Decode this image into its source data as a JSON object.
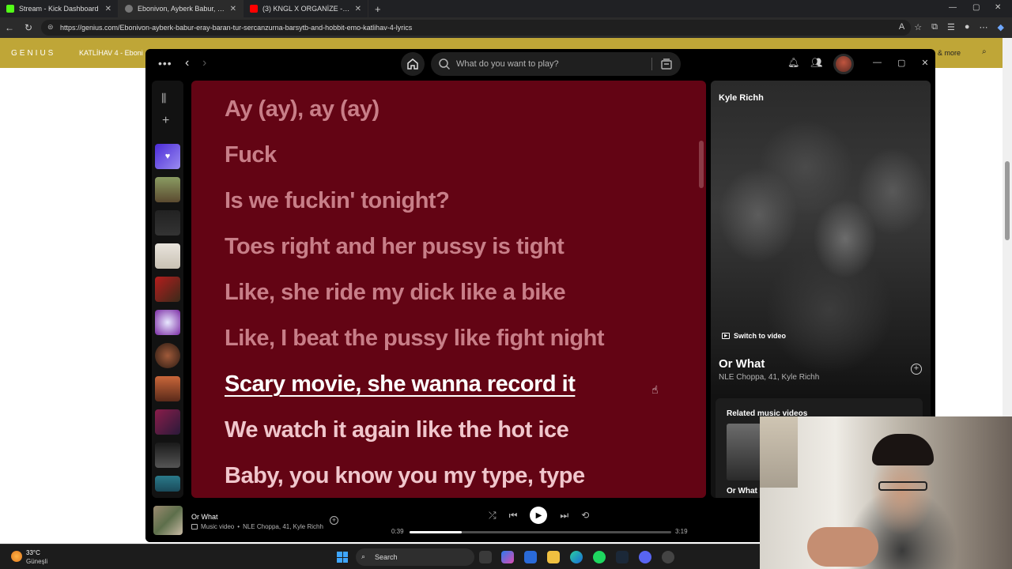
{
  "browser": {
    "tabs": [
      {
        "label": "Stream - Kick Dashboard",
        "color": "#53fc18"
      },
      {
        "label": "Ebonivon, Ayberk Babur, Eray, BA",
        "color": "#555555"
      },
      {
        "label": "(3) KNGL X ORGANİZE - KATLİHAV",
        "color": "#ff0000"
      }
    ],
    "new_tab": "+",
    "url": "https://genius.com/Ebonivon-ayberk-babur-eray-baran-tur-sercanzurna-barsytb-and-hobbit-emo-katlihav-4-lyrics"
  },
  "genius": {
    "logo": "GENIUS",
    "song_title": "KATLİHAV 4 - Eboni",
    "more": "& more"
  },
  "spotify": {
    "search_placeholder": "What do you want to play?",
    "lyrics": {
      "past": [
        "Ay (ay), ay (ay)",
        "Fuck",
        "Is we fuckin' tonight?",
        "Toes right and her pussy is tight",
        "Like, she ride my dick like a bike",
        "Like, I beat the pussy like fight night"
      ],
      "current": "Scary movie, she wanna record it",
      "future": [
        "We watch it again like the hot ice",
        "Baby, you know you my type, type"
      ]
    },
    "now_playing_panel": {
      "artist_header": "Kyle Richh",
      "switch_to_video": "Switch to video",
      "title": "Or What",
      "artists": "NLE Choppa, 41, Kyle Richh",
      "related_header": "Related music videos",
      "related_item": "Or What"
    },
    "player": {
      "title": "Or What",
      "type": "Music video",
      "artists": "NLE Choppa, 41, Kyle Richh",
      "elapsed": "0:39",
      "total": "3:19",
      "progress": 0.2
    }
  },
  "taskbar": {
    "temperature": "33°C",
    "condition": "Güneşli",
    "search": "Search"
  }
}
